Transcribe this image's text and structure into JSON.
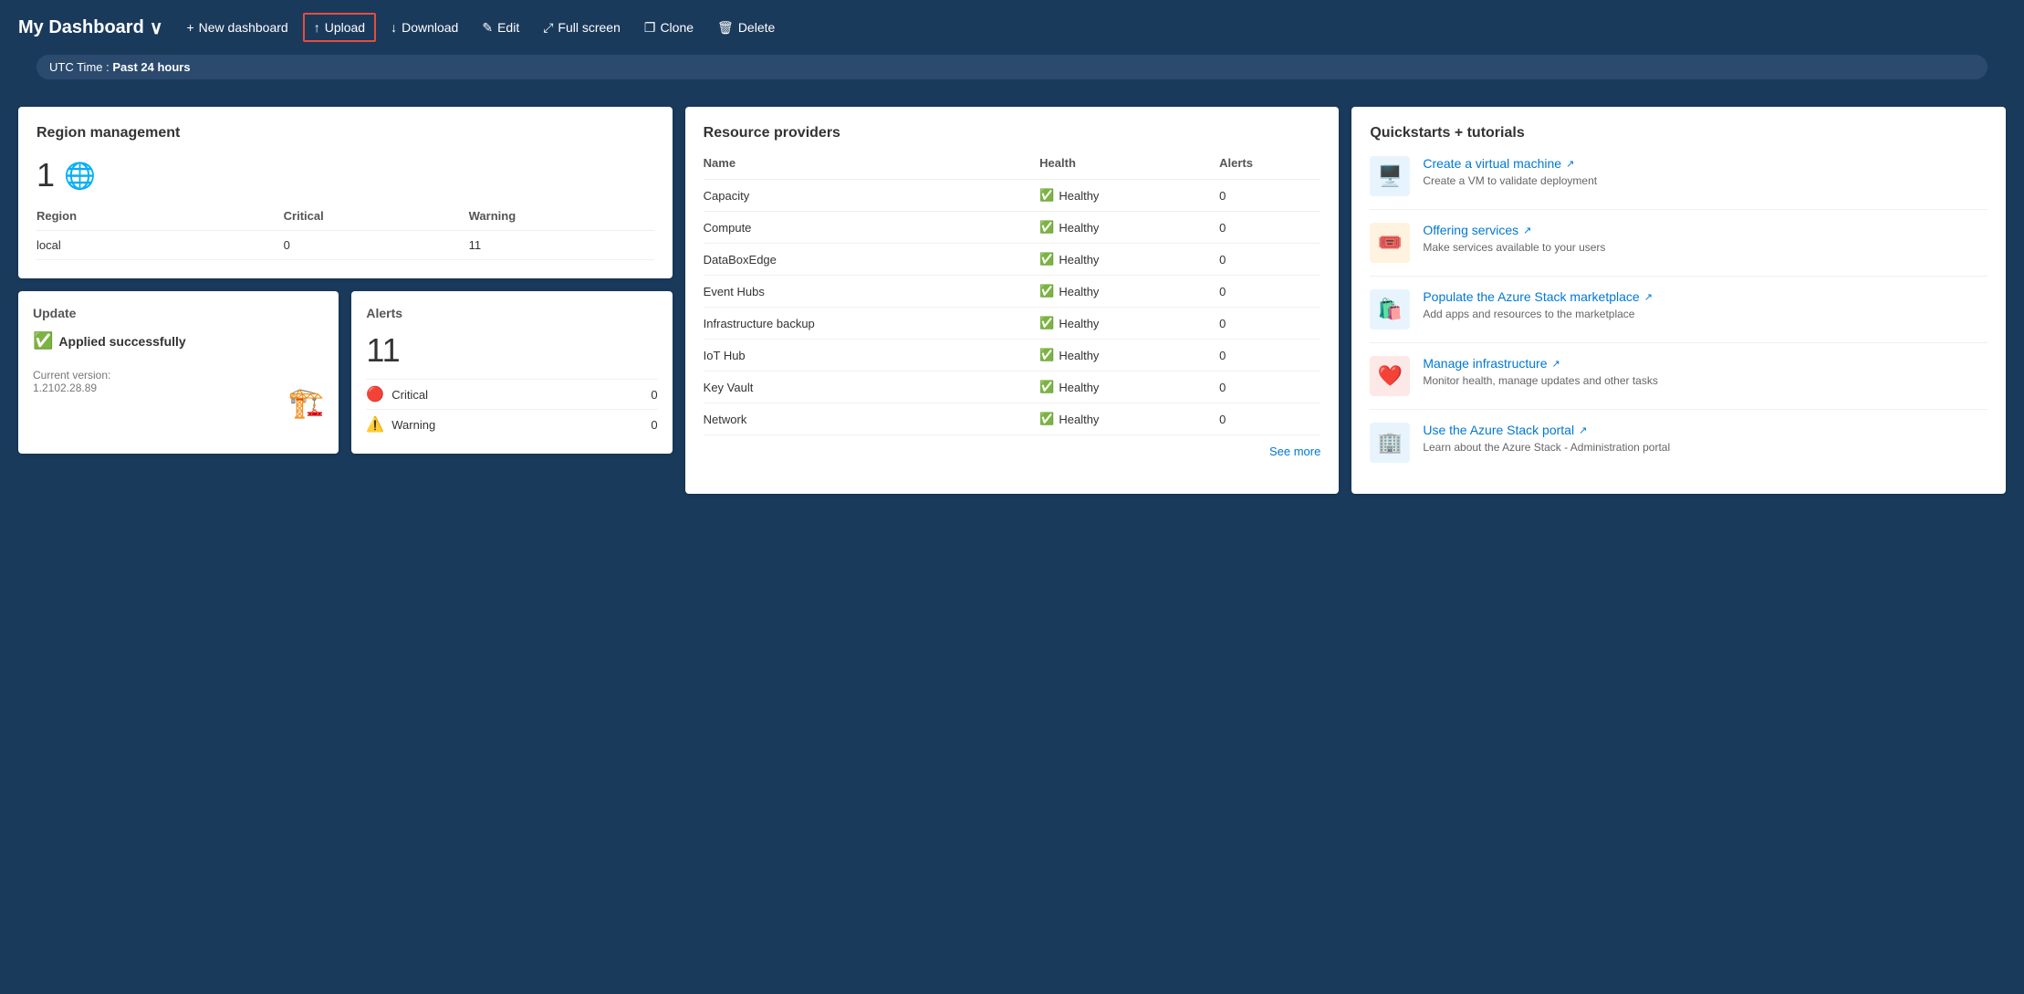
{
  "header": {
    "title": "My Dashboard",
    "chevron": "∨",
    "buttons": [
      {
        "id": "new-dashboard",
        "icon": "+",
        "label": "New dashboard"
      },
      {
        "id": "upload",
        "icon": "↑",
        "label": "Upload",
        "highlighted": true
      },
      {
        "id": "download",
        "icon": "↓",
        "label": "Download"
      },
      {
        "id": "edit",
        "icon": "✎",
        "label": "Edit"
      },
      {
        "id": "fullscreen",
        "icon": "⤢",
        "label": "Full screen"
      },
      {
        "id": "clone",
        "icon": "❐",
        "label": "Clone"
      },
      {
        "id": "delete",
        "icon": "🗑",
        "label": "Delete"
      }
    ]
  },
  "time_badge": {
    "prefix": "UTC Time : ",
    "value": "Past 24 hours"
  },
  "region_management": {
    "title": "Region management",
    "count": "1",
    "columns": [
      "Region",
      "Critical",
      "Warning"
    ],
    "rows": [
      {
        "region": "local",
        "critical": "0",
        "warning": "11"
      }
    ]
  },
  "update": {
    "title": "Update",
    "status": "Applied successfully",
    "version_label": "Current version:",
    "version": "1.2102.28.89"
  },
  "alerts": {
    "title": "Alerts",
    "count": "11",
    "rows": [
      {
        "icon": "critical",
        "label": "Critical",
        "count": "0"
      },
      {
        "icon": "warning",
        "label": "Warning",
        "count": "0"
      }
    ]
  },
  "resource_providers": {
    "title": "Resource providers",
    "columns": [
      "Name",
      "Health",
      "Alerts"
    ],
    "rows": [
      {
        "name": "Capacity",
        "health": "Healthy",
        "alerts": "0"
      },
      {
        "name": "Compute",
        "health": "Healthy",
        "alerts": "0"
      },
      {
        "name": "DataBoxEdge",
        "health": "Healthy",
        "alerts": "0"
      },
      {
        "name": "Event Hubs",
        "health": "Healthy",
        "alerts": "0"
      },
      {
        "name": "Infrastructure backup",
        "health": "Healthy",
        "alerts": "0"
      },
      {
        "name": "IoT Hub",
        "health": "Healthy",
        "alerts": "0"
      },
      {
        "name": "Key Vault",
        "health": "Healthy",
        "alerts": "0"
      },
      {
        "name": "Network",
        "health": "Healthy",
        "alerts": "0"
      }
    ],
    "see_more": "See more"
  },
  "quickstarts": {
    "title": "Quickstarts + tutorials",
    "items": [
      {
        "id": "create-vm",
        "icon": "🖥️",
        "icon_bg": "vm",
        "title": "Create a virtual machine",
        "title_ext": "↗",
        "desc": "Create a VM to validate deployment"
      },
      {
        "id": "offering-services",
        "icon": "🎟️",
        "icon_bg": "services",
        "title": "Offering services",
        "title_ext": "↗",
        "desc": "Make services available to your users"
      },
      {
        "id": "marketplace",
        "icon": "🛍️",
        "icon_bg": "marketplace",
        "title": "Populate the Azure Stack marketplace",
        "title_ext": "↗",
        "desc": "Add apps and resources to the marketplace"
      },
      {
        "id": "manage-infra",
        "icon": "❤️",
        "icon_bg": "infra",
        "title": "Manage infrastructure",
        "title_ext": "↗",
        "desc": "Monitor health, manage updates and other tasks"
      },
      {
        "id": "azure-portal",
        "icon": "🏢",
        "icon_bg": "portal",
        "title": "Use the Azure Stack portal",
        "title_ext": "↗",
        "desc": "Learn about the Azure Stack - Administration portal"
      }
    ]
  }
}
